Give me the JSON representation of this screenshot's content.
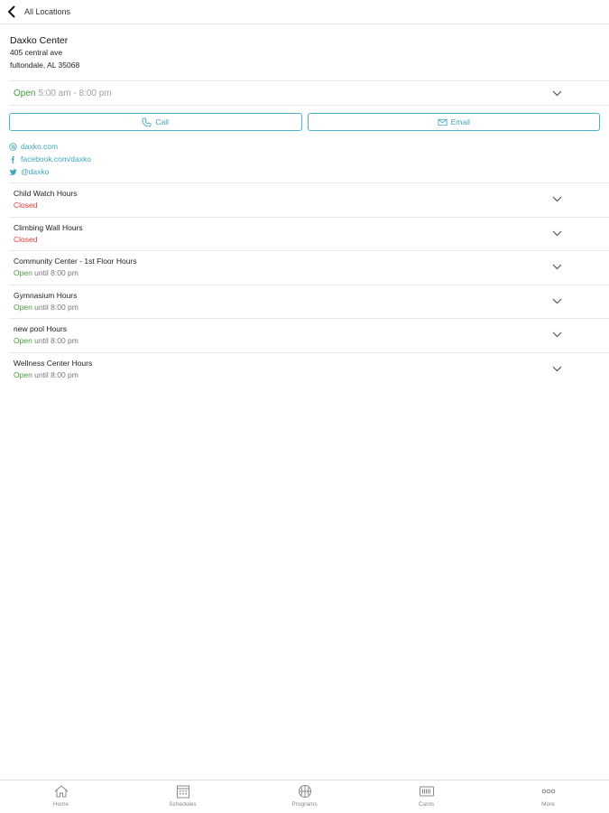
{
  "nav": {
    "back_label": "All Locations"
  },
  "center": {
    "name": "Daxko Center",
    "address_line1": "405 central ave",
    "address_line2": "fultondale, AL 35068"
  },
  "hours": {
    "status": "Open",
    "time": "5:00 am - 8:00 pm"
  },
  "actions": {
    "call_label": "Call",
    "email_label": "Email"
  },
  "links": {
    "website": "daxko.com",
    "facebook": "facebook.com/daxko",
    "twitter": "@daxko"
  },
  "amenities": [
    {
      "title": "Child Watch Hours",
      "status": "Closed",
      "detail": ""
    },
    {
      "title": "Climbing Wall Hours",
      "status": "Closed",
      "detail": ""
    },
    {
      "title": "Community Center - 1st Floor Hours",
      "status": "Open",
      "detail": "until 8:00 pm"
    },
    {
      "title": "Gymnasium Hours",
      "status": "Open",
      "detail": "until 8:00 pm"
    },
    {
      "title": "new pool Hours",
      "status": "Open",
      "detail": "until 8:00 pm"
    },
    {
      "title": "Wellness Center Hours",
      "status": "Open",
      "detail": "until 8:00 pm"
    }
  ],
  "tabs": {
    "home": "Home",
    "schedules": "Schedules",
    "programs": "Programs",
    "cards": "Cards",
    "more": "More"
  },
  "colors": {
    "accent": "#3fa5bb",
    "open": "#4a9a41",
    "closed": "#e4393c"
  }
}
